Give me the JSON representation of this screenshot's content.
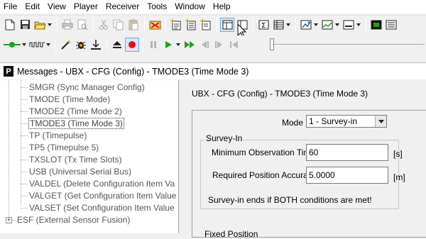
{
  "menu": [
    "File",
    "Edit",
    "View",
    "Player",
    "Receiver",
    "Tools",
    "Window",
    "Help"
  ],
  "window": {
    "title": "Messages - UBX - CFG (Config) - TMODE3 (Time Mode 3)",
    "icon_letter": "P"
  },
  "tree": {
    "items": [
      {
        "label": "SMGR (Sync Manager Config)",
        "selected": false
      },
      {
        "label": "TMODE (Time Mode)",
        "selected": false
      },
      {
        "label": "TMODE2 (Time Mode 2)",
        "selected": false
      },
      {
        "label": "TMODE3 (Time Mode 3)",
        "selected": true
      },
      {
        "label": "TP (Timepulse)",
        "selected": false
      },
      {
        "label": "TP5 (Timepulse 5)",
        "selected": false
      },
      {
        "label": "TXSLOT (Tx Time Slots)",
        "selected": false
      },
      {
        "label": "USB (Universal Serial Bus)",
        "selected": false
      },
      {
        "label": "VALDEL (Delete Configuration Item Va",
        "selected": false
      },
      {
        "label": "VALGET (Get Configuration Item Value",
        "selected": false
      },
      {
        "label": "VALSET (Set Configuration Item Value",
        "selected": false
      }
    ],
    "esf_label": "ESF (External Sensor Fusion)",
    "expander_symbol": "+"
  },
  "panel": {
    "title": "UBX - CFG (Config) - TMODE3 (Time Mode 3)",
    "mode_label": "Mode",
    "mode_value": "1 - Survey-in",
    "survey_group_label": "Survey-In",
    "min_obs_label": "Minimum Observation Time",
    "min_obs_value": "60",
    "min_obs_unit": "[s]",
    "req_acc_label": "Required Position Accuracy",
    "req_acc_value": "5.0000",
    "req_acc_unit": "[m]",
    "note": "Survey-in ends if BOTH conditions are met!",
    "fixed_position_label": "Fixed Position"
  },
  "colors": {
    "record": "#e01010",
    "play": "#1aa21a",
    "accent_blue": "#1f5fbf"
  }
}
